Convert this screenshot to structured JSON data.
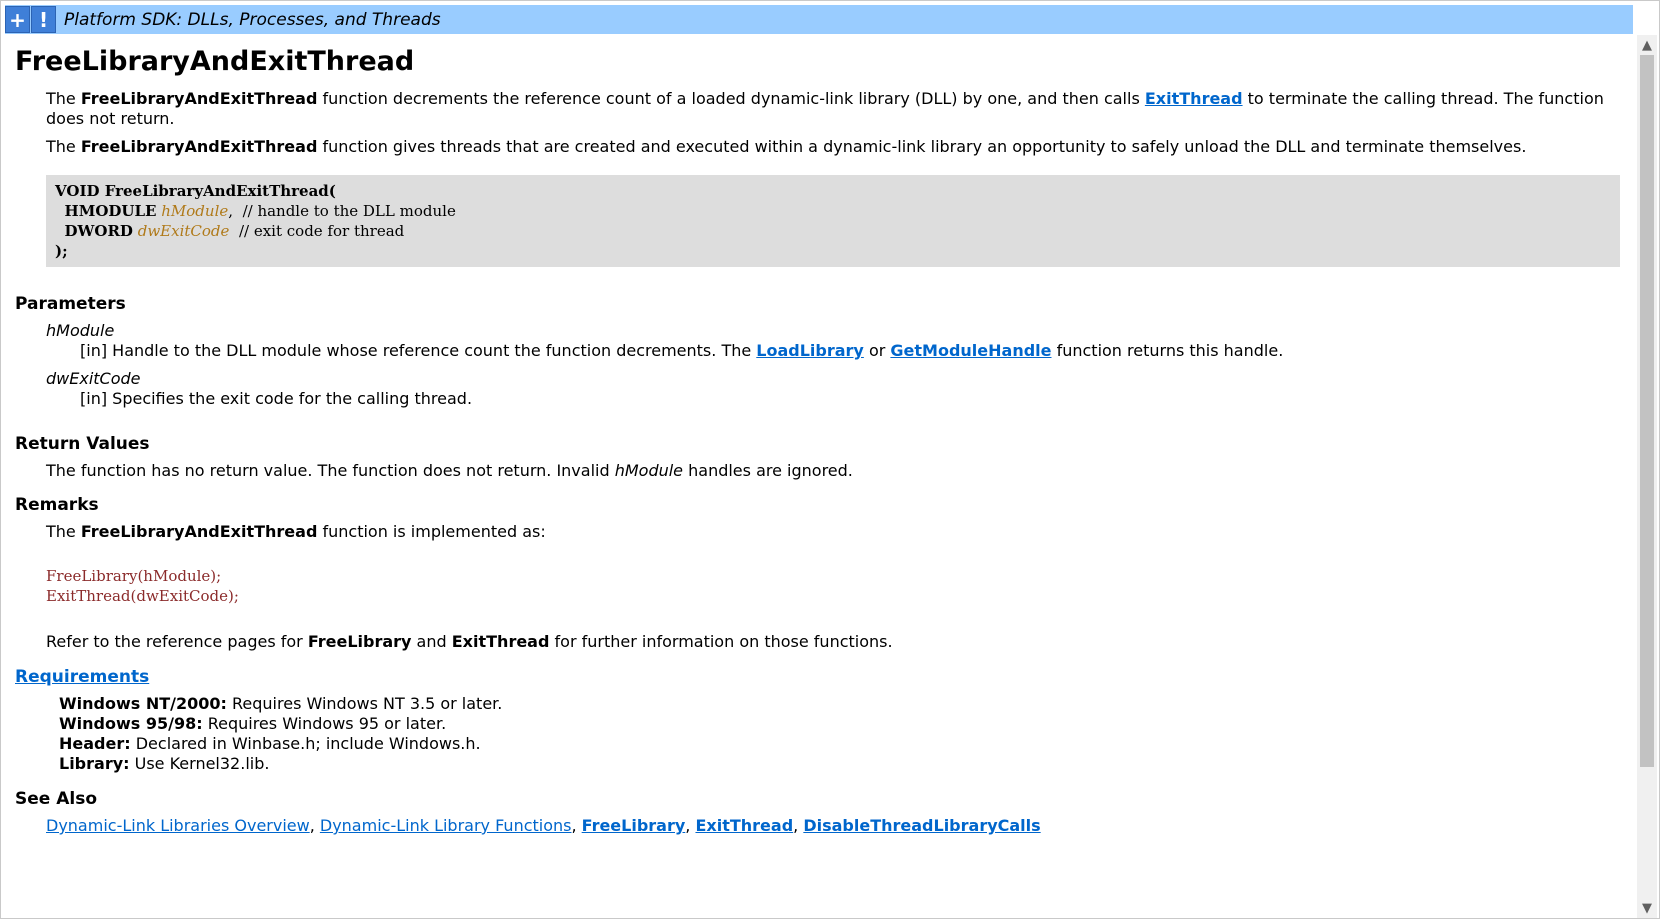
{
  "header": {
    "expand_icon": "+",
    "alert_icon": "!",
    "title": "Platform SDK: DLLs, Processes, and Threads"
  },
  "page": {
    "title": "FreeLibraryAndExitThread",
    "intro1": {
      "a": "The ",
      "b": "FreeLibraryAndExitThread",
      "c": " function decrements the reference count of a loaded dynamic-link library (DLL) by one, and then calls ",
      "link": "ExitThread",
      "d": " to terminate the calling thread. The function does not return."
    },
    "intro2": {
      "a": "The ",
      "b": "FreeLibraryAndExitThread",
      "c": " function gives threads that are created and executed within a dynamic-link library an opportunity to safely unload the DLL and terminate themselves."
    },
    "syntax": {
      "line1": "VOID FreeLibraryAndExitThread(",
      "p1_type": "HMODULE",
      "p1_name": "hModule",
      "p1_comment": "// handle to the DLL module",
      "p2_type": "DWORD",
      "p2_name": "dwExitCode",
      "p2_comment": "// exit code for thread",
      "close": ");"
    },
    "parameters": {
      "heading": "Parameters",
      "p1_name": "hModule",
      "p1_desc_a": "[in] Handle to the DLL module whose reference count the function decrements. The ",
      "p1_link1": "LoadLibrary",
      "p1_desc_b": " or ",
      "p1_link2": "GetModuleHandle",
      "p1_desc_c": " function returns this handle.",
      "p2_name": "dwExitCode",
      "p2_desc": "[in] Specifies the exit code for the calling thread."
    },
    "return_values": {
      "heading": "Return Values",
      "a": "The function has no return value. The function does not return. Invalid ",
      "i": "hModule",
      "b": " handles are ignored."
    },
    "remarks": {
      "heading": "Remarks",
      "a": "The ",
      "b": "FreeLibraryAndExitThread",
      "c": " function is implemented as:",
      "code1": "FreeLibrary(hModule);",
      "code2": "ExitThread(dwExitCode);",
      "ref_a": "Refer to the reference pages for ",
      "ref_b": "FreeLibrary",
      "ref_c": " and ",
      "ref_d": "ExitThread",
      "ref_e": " for further information on those functions."
    },
    "requirements": {
      "heading": "Requirements",
      "r1_label": "Windows NT/2000:",
      "r1_value": " Requires Windows NT 3.5 or later.",
      "r2_label": "Windows 95/98:",
      "r2_value": " Requires Windows 95 or later.",
      "r3_label": "Header:",
      "r3_value": " Declared in Winbase.h; include Windows.h.",
      "r4_label": "Library:",
      "r4_value": " Use Kernel32.lib."
    },
    "see_also": {
      "heading": "See Also",
      "links": [
        "Dynamic-Link Libraries Overview",
        "Dynamic-Link Library Functions",
        "FreeLibrary",
        "ExitThread",
        "DisableThreadLibraryCalls"
      ],
      "sep": ", "
    }
  },
  "scrollbar": {
    "up_icon": "▲",
    "down_icon": "▼"
  },
  "colors": {
    "header_bg": "#99ccff",
    "link": "#0066cc",
    "code_bg": "#dddddd",
    "param_name": "#b07a1a",
    "impl_code": "#8b2b2b"
  }
}
